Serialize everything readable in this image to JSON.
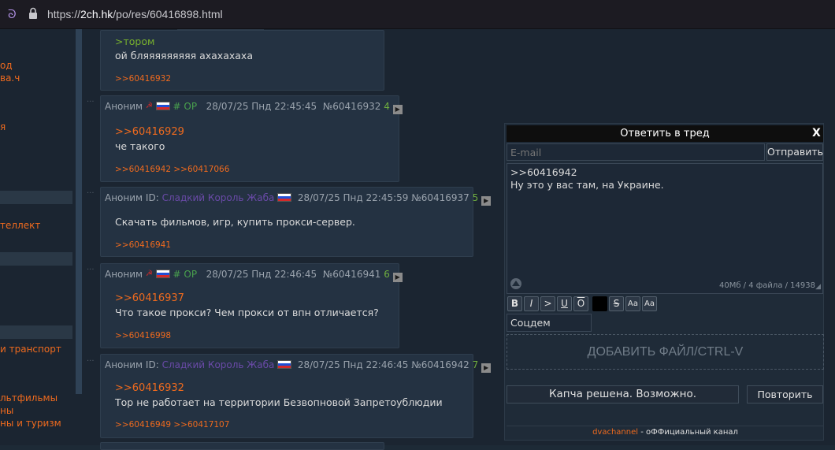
{
  "browser": {
    "url_prefix": "https://",
    "url_host": "2ch.hk",
    "url_path": "/po/res/60416898.html"
  },
  "nav": {
    "items": [
      {
        "label": "од"
      },
      {
        "label": "ва.ч"
      },
      {
        "label": "я"
      },
      {
        "label": "теллект"
      },
      {
        "label": "и транспорт"
      },
      {
        "label": "льтфильмы"
      },
      {
        "label": "ны"
      },
      {
        "label": "ны и туризм"
      }
    ]
  },
  "posts": [
    {
      "greentext": ">тором",
      "text": "ой бляяяяяяяяя ахахахаха",
      "replies": ">>60416932"
    },
    {
      "name": "Аноним",
      "op": "# OP",
      "date": "28/07/25 Пнд 22:45:45",
      "num": "№60416932",
      "count": "4",
      "reflink": ">>60416929",
      "text": "че такого",
      "replies": ">>60416942 >>60417066"
    },
    {
      "name": "Аноним ID:",
      "poster_id": "Сладкий Король Жаба",
      "date": "28/07/25 Пнд 22:45:59",
      "num": "№60416937",
      "count": "5",
      "text": "Скачать фильмов, игр, купить прокси-сервер.",
      "replies": ">>60416941"
    },
    {
      "name": "Аноним",
      "op": "# OP",
      "date": "28/07/25 Пнд 22:46:45",
      "num": "№60416941",
      "count": "6",
      "reflink": ">>60416937",
      "text": "Что такое прокси? Чем прокси от впн отличается?",
      "replies": ">>60416998"
    },
    {
      "name": "Аноним ID:",
      "poster_id": "Сладкий Король Жаба",
      "date": "28/07/25 Пнд 22:46:45",
      "num": "№60416942",
      "count": "7",
      "reflink": ">>60416932",
      "text": "Тор не работает на территории Безвопновой Запретоублюдии",
      "replies": ">>60416949 >>60417107"
    }
  ],
  "reply_form": {
    "title": "Ответить в тред",
    "close": "X",
    "email_placeholder": "E-mail",
    "send_label": "Отправить",
    "message_line1": ">>60416942",
    "message_line2": "Ну это у вас там, на Украине.",
    "limits": "40Мб / 4 файла / 14938",
    "format_buttons": [
      "B",
      "I",
      ">",
      "U",
      "O",
      "",
      "S",
      "Aa",
      "Aa"
    ],
    "icon_select": "Соцдем",
    "file_drop": "ДОБАВИТЬ ФАЙЛ/CTRL-V",
    "captcha_status": "Капча решена. Возможно.",
    "retry_label": "Повторить",
    "footer_link": "dvachannel",
    "footer_text": " - оФФициальный канал"
  }
}
